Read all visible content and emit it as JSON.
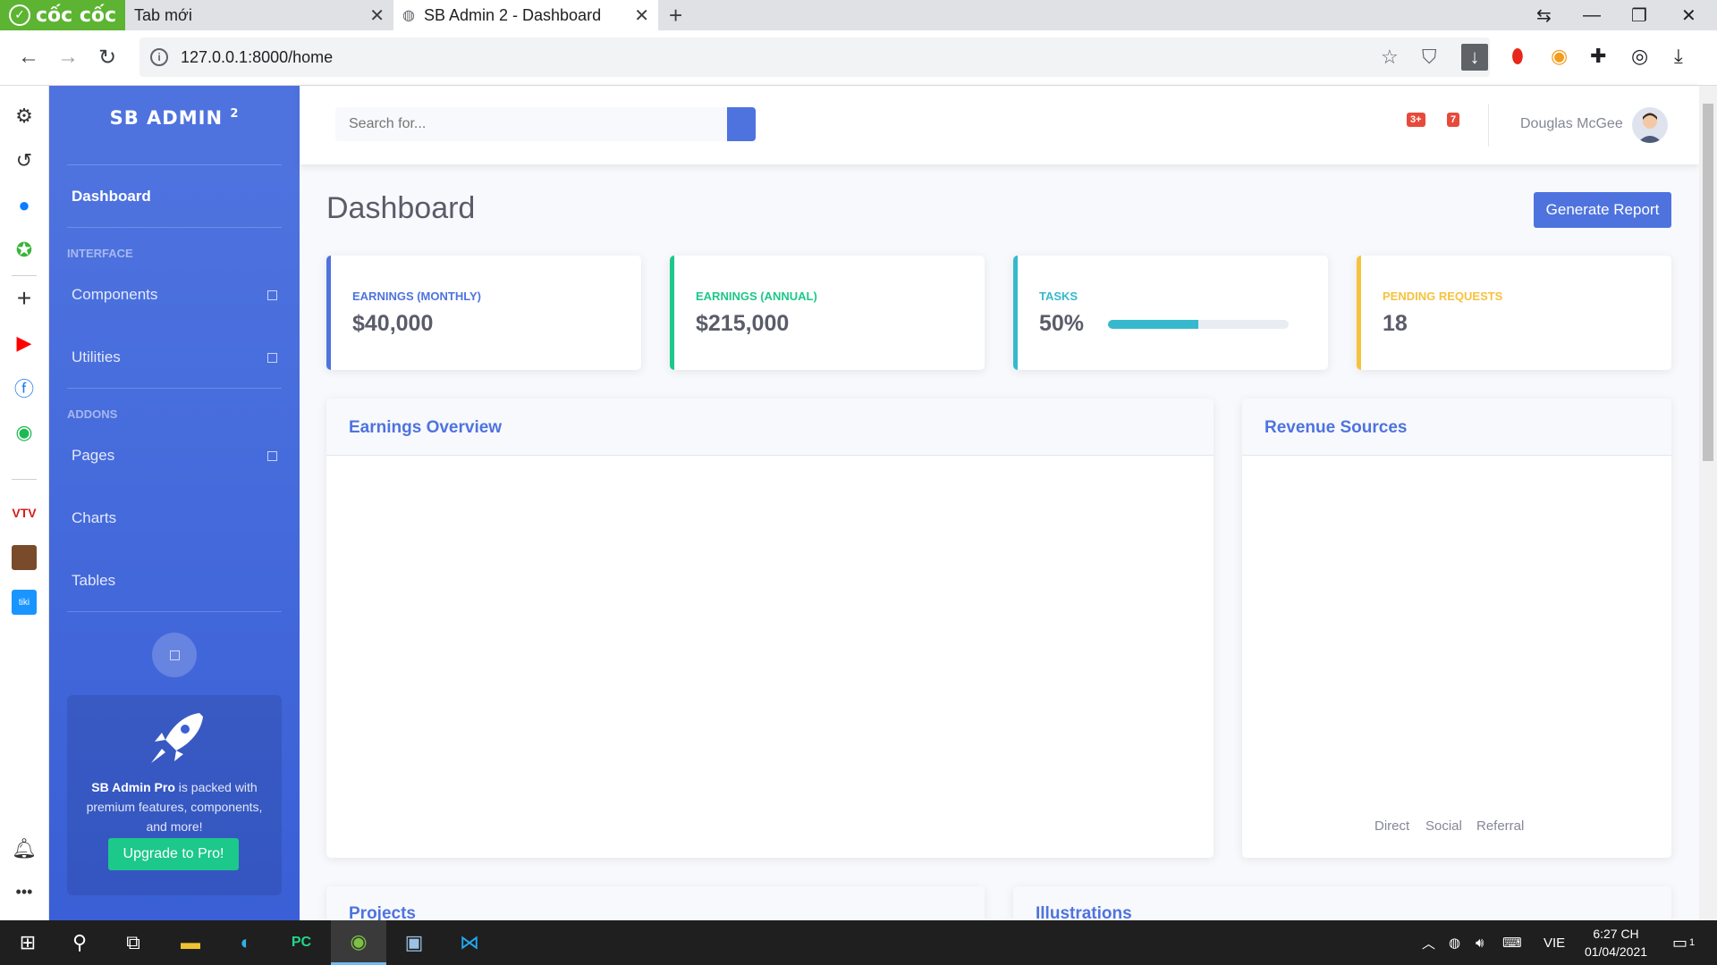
{
  "browser": {
    "brand": "cốc cốc",
    "tabs": [
      {
        "label": "Tab mới"
      },
      {
        "label": "SB Admin 2 - Dashboard"
      }
    ],
    "url": "127.0.0.1:8000/home"
  },
  "sidebar": {
    "brand": "SB ADMIN",
    "brand_sup": "2",
    "dashboard_label": "Dashboard",
    "heading_interface": "INTERFACE",
    "item_components": "Components",
    "item_utilities": "Utilities",
    "heading_addons": "ADDONS",
    "item_pages": "Pages",
    "item_charts": "Charts",
    "item_tables": "Tables",
    "promo_bold": "SB Admin Pro",
    "promo_text": "is packed with premium features, components, and more!",
    "promo_button": "Upgrade to Pro!"
  },
  "topbar": {
    "search_placeholder": "Search for...",
    "alerts_badge": "3+",
    "messages_badge": "7",
    "user_name": "Douglas McGee"
  },
  "main": {
    "page_title": "Dashboard",
    "generate_report": "Generate Report",
    "stats": [
      {
        "label": "EARNINGS (MONTHLY)",
        "value": "$40,000",
        "color": "#4e73df"
      },
      {
        "label": "EARNINGS (ANNUAL)",
        "value": "$215,000",
        "color": "#1cc88a"
      },
      {
        "label": "TASKS",
        "value": "50%",
        "progress": 0.5,
        "color": "#36b9cc"
      },
      {
        "label": "PENDING REQUESTS",
        "value": "18",
        "color": "#f6c23e"
      }
    ],
    "earnings_title": "Earnings Overview",
    "revenue_title": "Revenue Sources",
    "revenue_legend": [
      "Direct",
      "Social",
      "Referral"
    ],
    "projects_title": "Projects",
    "illustrations_title": "Illustrations"
  },
  "taskbar": {
    "lang": "VIE",
    "time": "6:27 CH",
    "date": "01/04/2021",
    "notif_count": "1"
  }
}
